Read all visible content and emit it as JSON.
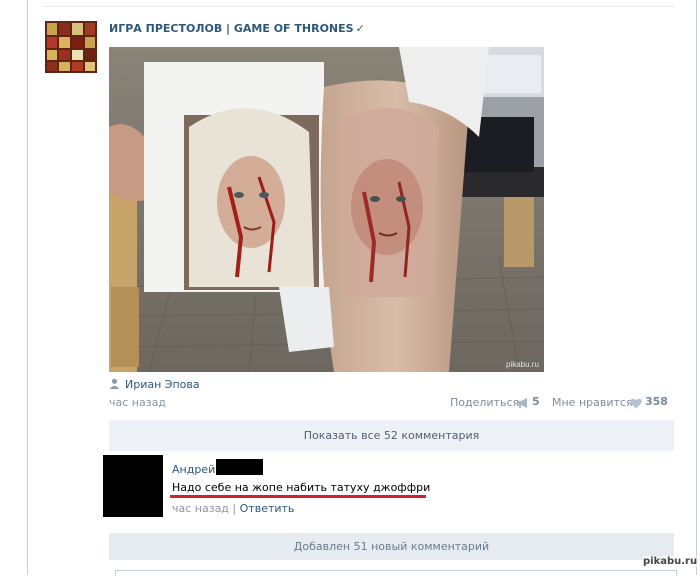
{
  "post": {
    "group_name": "ИГРА ПРЕСТОЛОВ | GAME OF THRONES",
    "verified_mark": "✓",
    "author": "Ириан Эпова",
    "time": "час назад",
    "share_label": "Поделиться",
    "share_count": "5",
    "like_label": "Мне нравится",
    "like_count": "358"
  },
  "comments": {
    "show_all_label": "Показать все 52 комментария",
    "items": [
      {
        "author": "Андрей",
        "text": "Надо себе на жопе набить татуху джоффри",
        "time": "час назад",
        "separator": "|",
        "reply_label": "Ответить"
      }
    ],
    "added_label": "Добавлен 51 новый комментарий"
  },
  "watermark": "pikabu.ru",
  "photo_watermark": "pikabu.ru",
  "icons": {
    "author": "user-icon",
    "share": "megaphone-icon",
    "like": "heart-icon"
  },
  "colors": {
    "link": "#2b587a",
    "muted": "#8a94a0",
    "button_bg": "#edf1f5",
    "highlight": "#d4202c"
  }
}
